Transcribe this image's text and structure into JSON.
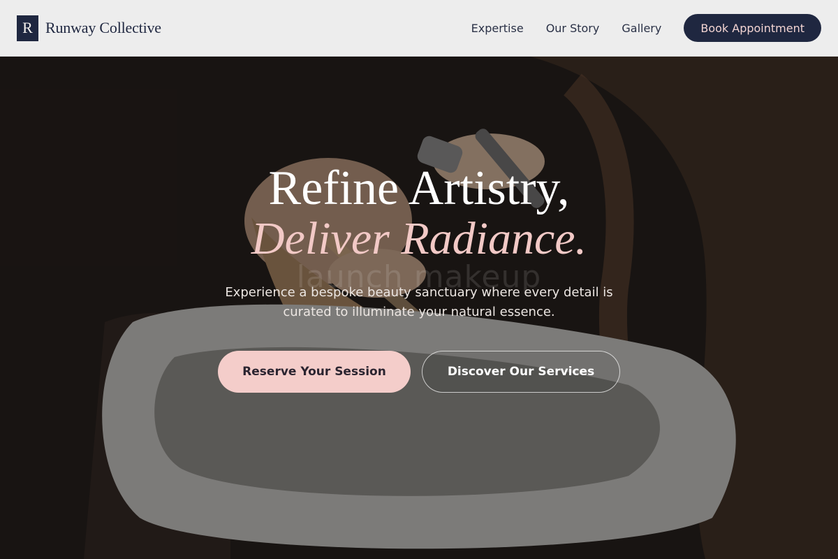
{
  "header": {
    "logo_letter": "R",
    "brand_name": "Runway Collective",
    "nav": [
      {
        "label": "Expertise"
      },
      {
        "label": "Our Story"
      },
      {
        "label": "Gallery"
      }
    ],
    "book_label": "Book Appointment"
  },
  "hero": {
    "headline_line1": "Refine Artistry,",
    "headline_line2": "Deliver Radiance.",
    "ghost_text": "launch makeup",
    "subtitle": "Experience a bespoke beauty sanctuary where every detail is curated to illuminate your natural essence.",
    "cta_primary": "Reserve Your Session",
    "cta_secondary": "Discover Our Services"
  },
  "colors": {
    "navy": "#1f2740",
    "blush": "#f4cdca",
    "accent_text": "#f2c9c6"
  }
}
